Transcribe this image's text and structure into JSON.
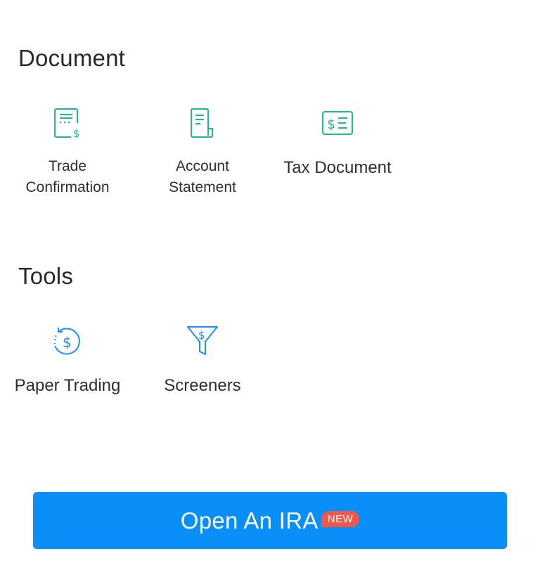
{
  "document": {
    "title": "Document",
    "items": [
      {
        "label_line1": "Trade",
        "label_line2": "Confirmation",
        "icon": "trade-confirmation-icon"
      },
      {
        "label_line1": "Account",
        "label_line2": "Statement",
        "icon": "account-statement-icon"
      },
      {
        "label": "Tax Document",
        "icon": "tax-document-icon"
      }
    ]
  },
  "tools": {
    "title": "Tools",
    "items": [
      {
        "label": "Paper Trading",
        "icon": "paper-trading-icon"
      },
      {
        "label": "Screeners",
        "icon": "screener-funnel-icon"
      }
    ]
  },
  "ira": {
    "label": "Open An IRA",
    "badge": "NEW"
  },
  "colors": {
    "document_icon": "#21b98c",
    "tools_icon": "#1a8ff5",
    "button_bg": "#0a8ef8",
    "badge_bg": "#f0584a"
  }
}
